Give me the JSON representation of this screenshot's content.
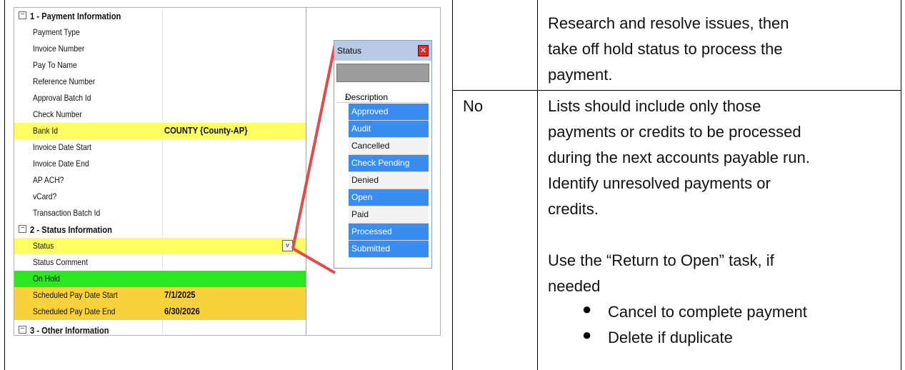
{
  "screenshot": {
    "groups": [
      {
        "label": "1 - Payment Information",
        "fields": [
          {
            "label": "Payment Type",
            "value": ""
          },
          {
            "label": "Invoice Number",
            "value": ""
          },
          {
            "label": "Pay To Name",
            "value": ""
          },
          {
            "label": "Reference Number",
            "value": ""
          },
          {
            "label": "Approval Batch Id",
            "value": ""
          },
          {
            "label": "Check Number",
            "value": ""
          },
          {
            "label": "Bank Id",
            "value": "COUNTY {County-AP}",
            "highlight": "yellow"
          },
          {
            "label": "Invoice Date Start",
            "value": ""
          },
          {
            "label": "Invoice Date End",
            "value": ""
          },
          {
            "label": "AP ACH?",
            "value": ""
          },
          {
            "label": "vCard?",
            "value": ""
          },
          {
            "label": "Transaction Batch Id",
            "value": ""
          }
        ]
      },
      {
        "label": "2 - Status Information",
        "fields": [
          {
            "label": "Status",
            "value": "",
            "highlight": "yellow"
          },
          {
            "label": "Status Comment",
            "value": ""
          },
          {
            "label": "On Hold",
            "value": "",
            "highlight": "green"
          },
          {
            "label": "Scheduled Pay Date Start",
            "value": "7/1/2025",
            "highlight": "orange"
          },
          {
            "label": "Scheduled Pay Date End",
            "value": "6/30/2026",
            "highlight": "orange"
          }
        ]
      },
      {
        "label": "3 - Other Information"
      }
    ],
    "popup": {
      "title": "Status",
      "column_header": "Description",
      "items": [
        {
          "label": "Approved",
          "selected": true
        },
        {
          "label": "Audit",
          "selected": true
        },
        {
          "label": "Cancelled",
          "selected": false
        },
        {
          "label": "Check Pending",
          "selected": true
        },
        {
          "label": "Denied",
          "selected": false
        },
        {
          "label": "Open",
          "selected": true
        },
        {
          "label": "Paid",
          "selected": false
        },
        {
          "label": "Processed",
          "selected": true
        },
        {
          "label": "Submitted",
          "selected": true
        }
      ]
    }
  },
  "table": {
    "row1_action": [
      "Research and resolve issues, then",
      "take off hold status to process the",
      "payment."
    ],
    "row2_answer": "No",
    "row2_action": [
      "Lists should include only those",
      "payments or credits to be processed",
      "during the next accounts payable run.",
      "Identify unresolved payments or",
      "credits."
    ],
    "row2_note": [
      "Use the “Return to Open” task, if",
      "needed"
    ],
    "row2_bullets": [
      "Cancel to complete payment",
      "Delete if duplicate"
    ]
  },
  "colors": {
    "yellow": "#fefe63",
    "green": "#29e81f",
    "orange": "#f7d23a",
    "selected": "#3a8df0",
    "connector": "#e24b4b"
  }
}
